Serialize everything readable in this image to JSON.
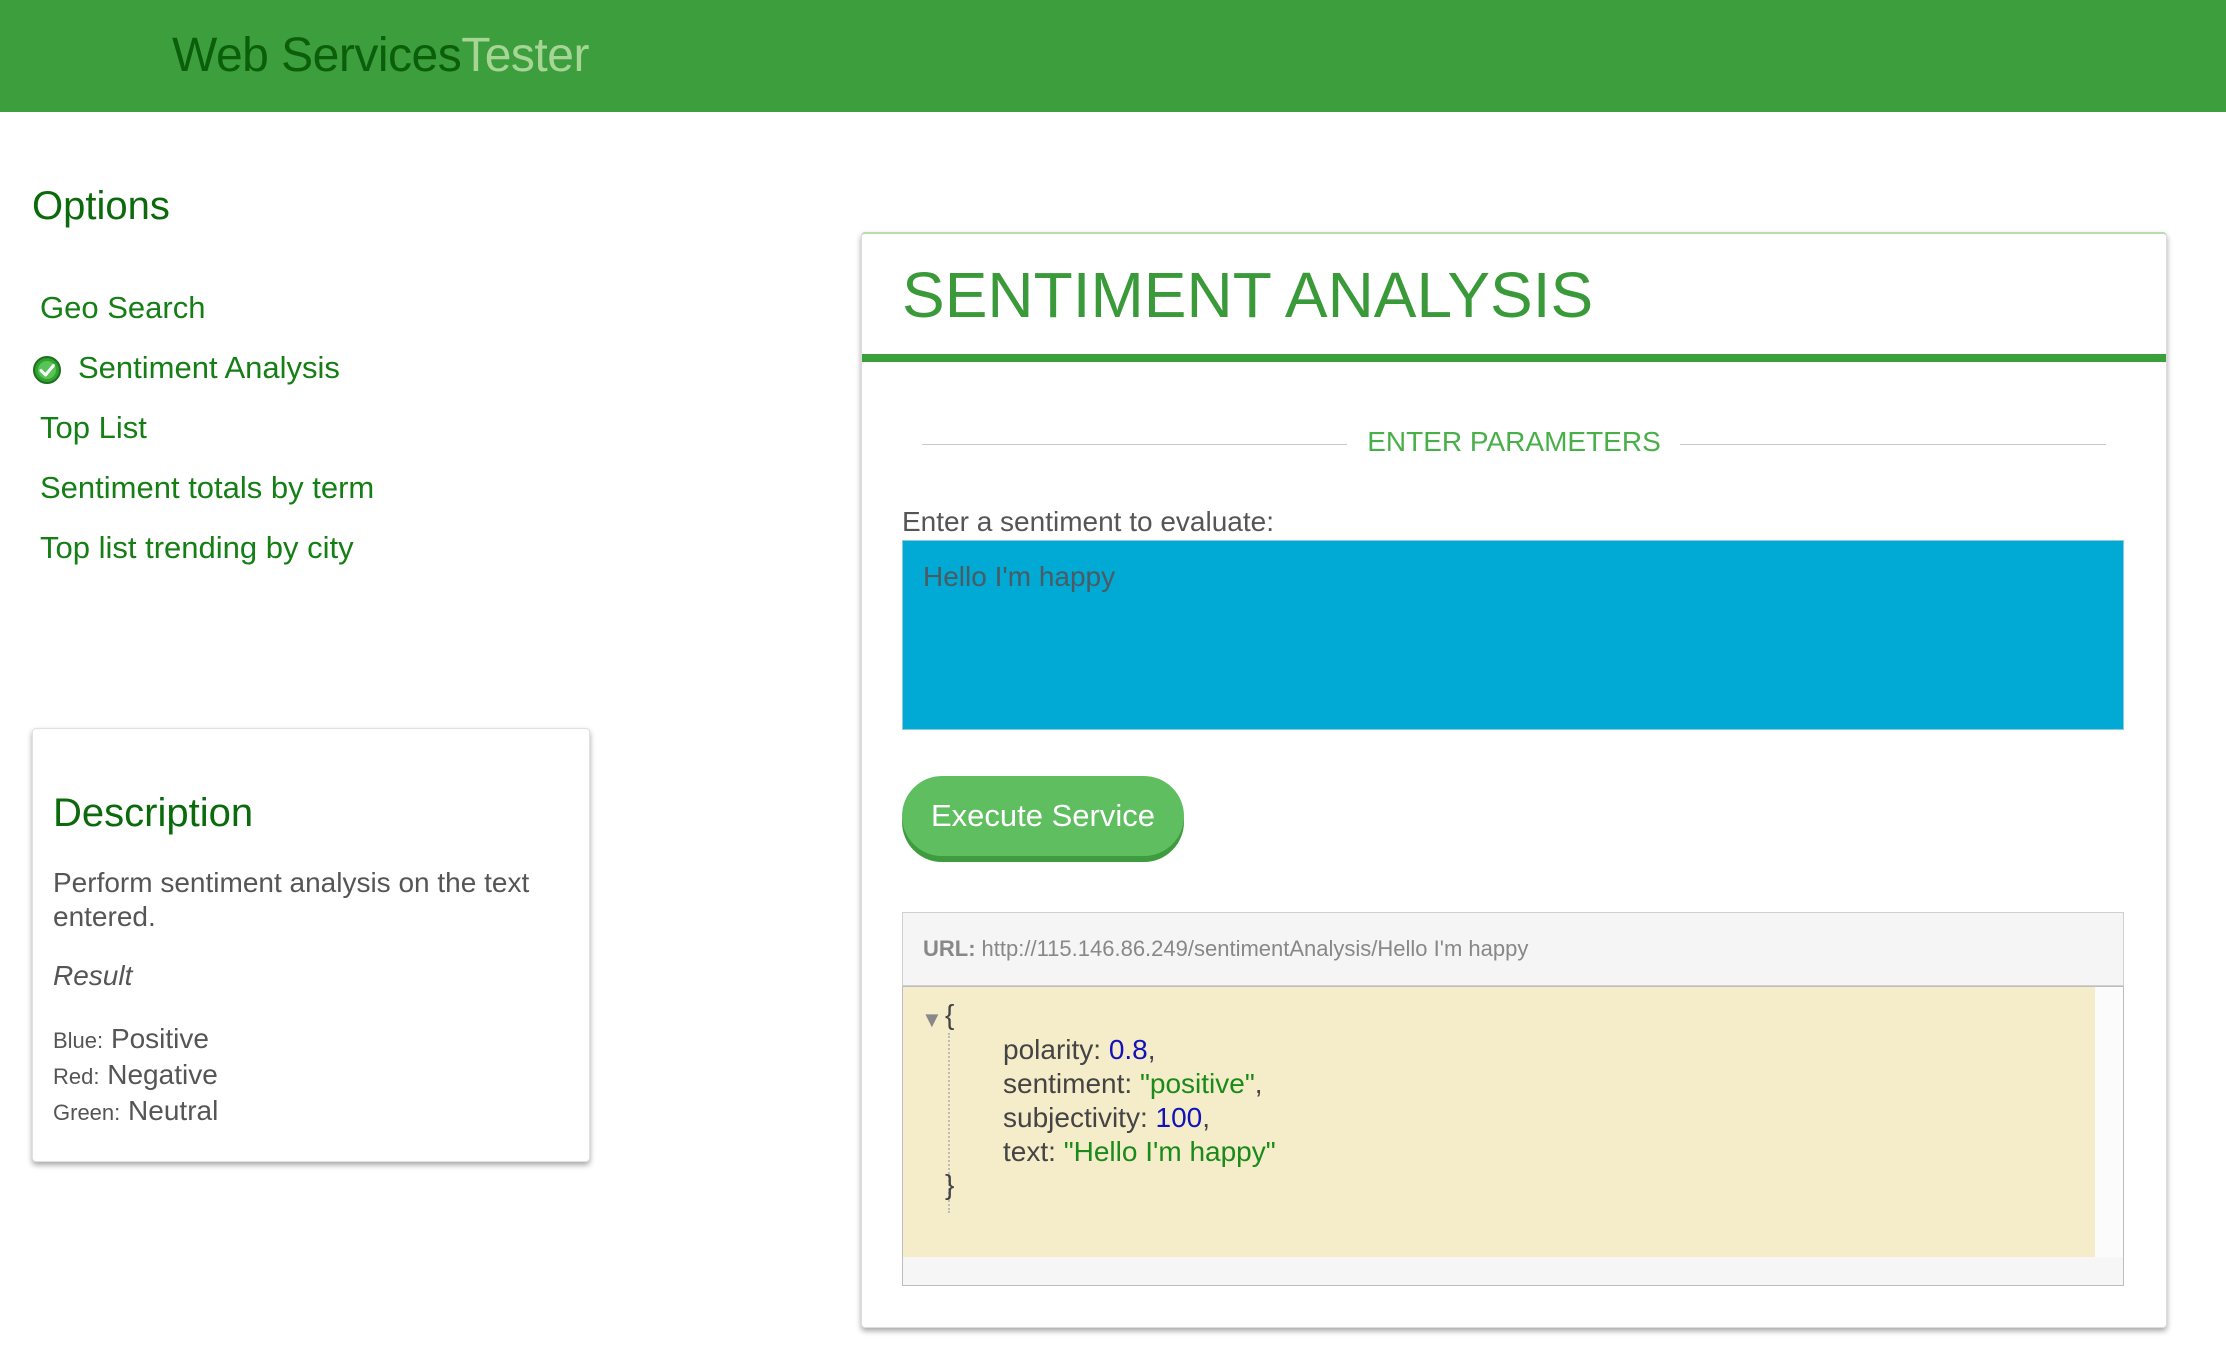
{
  "header": {
    "brand_part1": "Web Services",
    "brand_part2": "Tester"
  },
  "sidebar": {
    "title": "Options",
    "items": [
      {
        "label": "Geo Search"
      },
      {
        "label": "Sentiment Analysis"
      },
      {
        "label": "Top List"
      },
      {
        "label": "Sentiment totals by term"
      },
      {
        "label": "Top list trending by city"
      }
    ],
    "active_index": 1
  },
  "description": {
    "title": "Description",
    "text": "Perform sentiment analysis on the text entered.",
    "result_label": "Result",
    "legend": [
      {
        "key": "Blue:",
        "value": "Positive"
      },
      {
        "key": "Red:",
        "value": "Negative"
      },
      {
        "key": "Green:",
        "value": "Neutral"
      }
    ]
  },
  "main": {
    "title": "SENTIMENT ANALYSIS",
    "section_label": "ENTER PARAMETERS",
    "input_label": "Enter a sentiment to evaluate:",
    "input_value": "Hello I'm happy",
    "execute_label": "Execute Service",
    "url_key": "URL:",
    "url_value": "http://115.146.86.249/sentimentAnalysis/Hello I'm happy",
    "json": {
      "open": "{",
      "close": "}",
      "polarity_key": "polarity:",
      "polarity_value": "0.8",
      "sentiment_key": "sentiment:",
      "sentiment_value": "\"positive\"",
      "subjectivity_key": "subjectivity:",
      "subjectivity_value": "100",
      "text_key": "text:",
      "text_value": "\"Hello I'm happy\"",
      "comma": ","
    }
  },
  "colors": {
    "header_bg": "#3c9e3c",
    "accent_green": "#3a9a3a",
    "input_bg": "#00aad5",
    "button_bg": "#5fbe5f",
    "json_bg": "#f5ecca"
  }
}
